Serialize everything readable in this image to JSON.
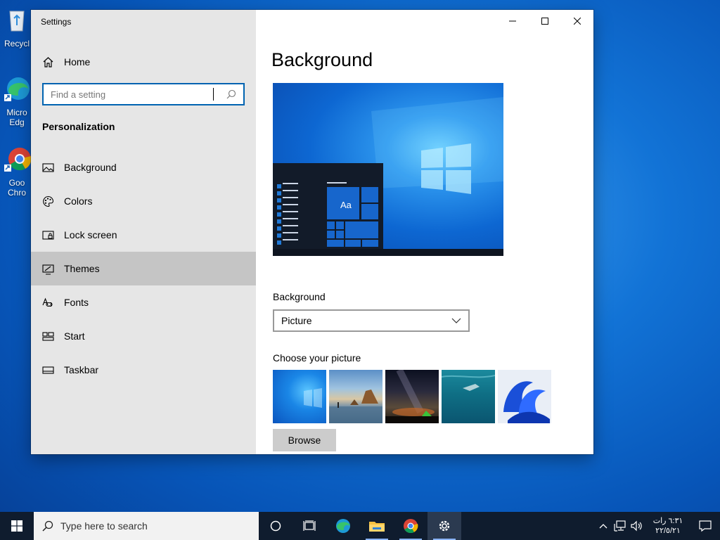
{
  "desktop": {
    "icons": [
      {
        "name": "recycle-bin",
        "label1": "Recycl",
        "label2": ""
      },
      {
        "name": "microsoft-edge",
        "label1": "Micro",
        "label2": "Edg"
      },
      {
        "name": "google-chrome",
        "label1": "Goo",
        "label2": "Chro"
      }
    ]
  },
  "window": {
    "title": "Settings",
    "icons": {
      "minimize": "minimize-icon",
      "maximize": "maximize-icon",
      "close": "close-icon"
    }
  },
  "sidebar": {
    "home_label": "Home",
    "search": {
      "placeholder": "Find a setting",
      "value": ""
    },
    "section": "Personalization",
    "items": [
      {
        "label": "Background",
        "icon": "picture-icon",
        "active": false
      },
      {
        "label": "Colors",
        "icon": "palette-icon",
        "active": false
      },
      {
        "label": "Lock screen",
        "icon": "lock-screen-icon",
        "active": false
      },
      {
        "label": "Themes",
        "icon": "themes-icon",
        "active": true
      },
      {
        "label": "Fonts",
        "icon": "fonts-icon",
        "active": false
      },
      {
        "label": "Start",
        "icon": "start-icon",
        "active": false
      },
      {
        "label": "Taskbar",
        "icon": "taskbar-icon",
        "active": false
      }
    ]
  },
  "content": {
    "title": "Background",
    "preview_text": "Aa",
    "background_label": "Background",
    "background_value": "Picture",
    "choose_label": "Choose your picture",
    "browse_label": "Browse"
  },
  "taskbar": {
    "search_placeholder": "Type here to search",
    "clock_line1": "٦:٣١ رات",
    "clock_line2": "٢٢/٥/٢١"
  },
  "colors": {
    "accent": "#0063b1",
    "sidebar_bg": "#e6e6e6",
    "active_item": "#c5c5c5",
    "taskbar_bg": "#0f1c2e"
  }
}
